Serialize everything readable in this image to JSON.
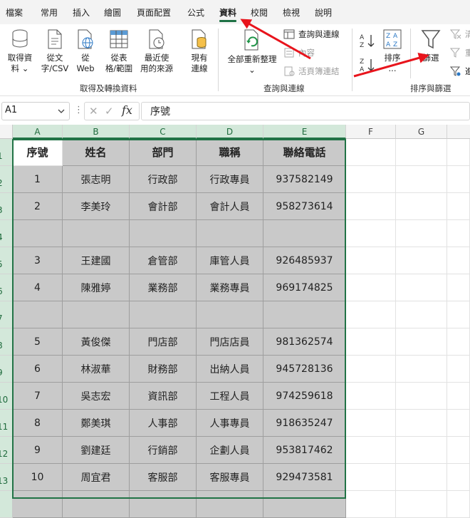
{
  "menu": {
    "tabs": [
      "檔案",
      "常用",
      "插入",
      "繪圖",
      "頁面配置",
      "公式",
      "資料",
      "校閱",
      "檢視",
      "說明"
    ],
    "active": "資料"
  },
  "ribbon": {
    "get_transform": {
      "group_label": "取得及轉換資料",
      "get_data": "取得資\n料 ⌄",
      "from_text_csv": "從文\n字/CSV",
      "from_web": "從\nWeb",
      "from_table": "從表\n格/範圍",
      "recent_sources": "最近使\n用的來源",
      "existing_connections": "現有\n連線"
    },
    "queries": {
      "group_label": "查詢與連線",
      "refresh_all": "全部重新整理",
      "refresh_caret": "⌄",
      "queries_connections": "查詢與連線",
      "properties": "內容",
      "edit_links": "活頁簿連結"
    },
    "sort_filter": {
      "group_label": "排序與篩選",
      "sort": "排序",
      "filter": "篩選",
      "clear_partial": "清",
      "reapply_partial": "重",
      "advanced_partial": "進",
      "more": "..."
    }
  },
  "formula_bar": {
    "name_box": "A1",
    "cancel": "✕",
    "enter": "✓",
    "fx": "fx",
    "content": "序號"
  },
  "sheet": {
    "columns": [
      "A",
      "B",
      "C",
      "D",
      "E",
      "F",
      "G"
    ],
    "row_numbers": [
      "1",
      "2",
      "3",
      "4",
      "5",
      "6",
      "7",
      "8",
      "9",
      "10",
      "11",
      "12",
      "13"
    ],
    "headers": [
      "序號",
      "姓名",
      "部門",
      "職稱",
      "聯絡電話"
    ],
    "rows": [
      [
        "1",
        "張志明",
        "行政部",
        "行政專員",
        "937582149"
      ],
      [
        "2",
        "李美玲",
        "會計部",
        "會計人員",
        "958273614"
      ],
      [
        "",
        "",
        "",
        "",
        ""
      ],
      [
        "3",
        "王建國",
        "倉管部",
        "庫管人員",
        "926485937"
      ],
      [
        "4",
        "陳雅婷",
        "業務部",
        "業務專員",
        "969174825"
      ],
      [
        "",
        "",
        "",
        "",
        ""
      ],
      [
        "5",
        "黃俊傑",
        "門店部",
        "門店店員",
        "981362574"
      ],
      [
        "6",
        "林淑華",
        "財務部",
        "出納人員",
        "945728136"
      ],
      [
        "7",
        "吳志宏",
        "資訊部",
        "工程人員",
        "974259618"
      ],
      [
        "8",
        "鄭美琪",
        "人事部",
        "人事專員",
        "918635247"
      ],
      [
        "9",
        "劉建廷",
        "行銷部",
        "企劃人員",
        "953817462"
      ],
      [
        "10",
        "周宜君",
        "客服部",
        "客服專員",
        "929473581"
      ],
      [
        "",
        "",
        "",
        "",
        ""
      ]
    ]
  },
  "colors": {
    "accent": "#217346",
    "selected_fill": "#c9c9c9",
    "header_selected": "#d3e8da",
    "arrow": "#e8141c"
  }
}
